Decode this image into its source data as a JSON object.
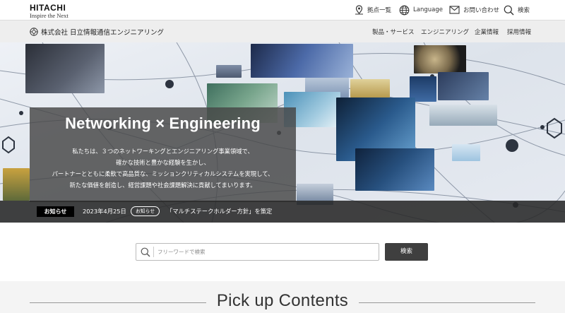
{
  "header": {
    "brand": "HITACHI",
    "tagline": "Inspire the Next",
    "utility": [
      {
        "label": "拠点一覧",
        "icon": "map-pin-icon"
      },
      {
        "label": "Language",
        "icon": "globe-icon"
      },
      {
        "label": "お問い合わせ",
        "icon": "mail-icon"
      },
      {
        "label": "検索",
        "icon": "search-icon"
      }
    ]
  },
  "company": {
    "name": "株式会社 日立情報通信エンジニアリング",
    "nav": [
      "製品・サービス",
      "エンジニアリング",
      "企業情報",
      "採用情報"
    ]
  },
  "hero": {
    "title": "Networking × Engineering",
    "lines": [
      "私たちは、３つのネットワーキングとエンジニアリング事業領域で、",
      "確かな技術と豊かな経験を生かし、",
      "パートナーとともに柔軟で高品質な、ミッションクリティカルシステムを実現して、",
      "新たな価値を創造し、経営課題や社会課題解決に貢献してまいります。"
    ]
  },
  "news": {
    "label": "お知らせ",
    "date": "2023年4月25日",
    "category": "お知らせ",
    "title": "「マルチステークホルダー方針」を策定"
  },
  "search": {
    "placeholder": "フリーワードで検索",
    "value": "",
    "button": "検索"
  },
  "pickup": {
    "title": "Pick up Contents"
  },
  "colors": {
    "overlay": "#464646",
    "newsbar": "#282828",
    "button": "#3f3f3f",
    "accent": "#1e3a6e"
  }
}
